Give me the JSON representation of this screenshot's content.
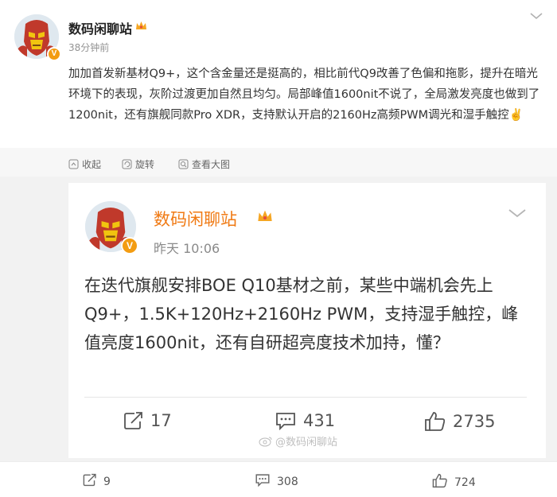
{
  "post": {
    "author": "数码闲聊站",
    "time": "38分钟前",
    "body": "加加首发新基材Q9+，这个含金量还是挺高的，相比前代Q9改善了色偏和拖影，提升在暗光环境下的表现，灰阶过渡更加自然且均匀。局部峰值1600nit不说了，全局激发亮度也做到了1200nit，还有旗舰同款Pro XDR，支持默认开启的2160Hz高频PWM调光和湿手触控✌️",
    "verified_badge": "V",
    "tools": {
      "collapse": "收起",
      "rotate": "旋转",
      "view_large": "查看大图"
    },
    "counts": {
      "repost": "9",
      "comment": "308",
      "like": "724"
    }
  },
  "card": {
    "author": "数码闲聊站",
    "time": "昨天 10:06",
    "verified_badge": "V",
    "body": "在迭代旗舰安排BOE Q10基材之前，某些中端机会先上Q9+，1.5K+120Hz+2160Hz PWM，支持湿手触控，峰值亮度1600nit，还有自研超亮度技术加持，懂？",
    "counts": {
      "repost": "17",
      "comment": "431",
      "like": "2735"
    }
  },
  "watermark": "@数码闲聊站",
  "icons": {
    "crown": "crown-icon",
    "chevron": "chevron-down-icon",
    "repost": "share-icon",
    "comment": "comment-icon",
    "like": "thumbs-up-icon"
  },
  "colors": {
    "card_author": "#f07a14",
    "verified": "#f39c12",
    "background": "#f2f2f2"
  }
}
